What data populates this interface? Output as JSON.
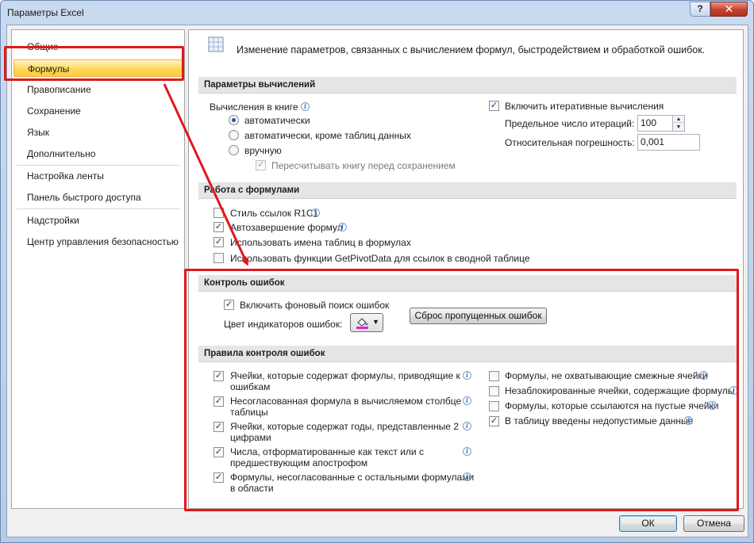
{
  "window": {
    "title": "Параметры Excel",
    "help_label": "?",
    "close_label": "✕"
  },
  "sidebar": {
    "items": [
      {
        "label": "Общие"
      },
      {
        "label": "Формулы",
        "selected": true
      },
      {
        "label": "Правописание"
      },
      {
        "label": "Сохранение"
      },
      {
        "label": "Язык"
      },
      {
        "label": "Дополнительно"
      },
      {
        "label": "Настройка ленты"
      },
      {
        "label": "Панель быстрого доступа"
      },
      {
        "label": "Надстройки"
      },
      {
        "label": "Центр управления безопасностью"
      }
    ]
  },
  "header": {
    "icon": "fx-formula-icon",
    "icon_glyph": "fx",
    "text": "Изменение параметров, связанных с вычислением формул, быстродействием и обработкой ошибок."
  },
  "calc": {
    "title": "Параметры вычислений",
    "workbook_label": "Вычисления в книге",
    "mode_auto": "автоматически",
    "mode_auto_except": "автоматически, кроме таблиц данных",
    "mode_manual": "вручную",
    "recalc_before_save": "Пересчитывать книгу перед сохранением",
    "iterative": "Включить итеративные вычисления",
    "max_iter_label": "Предельное число итераций:",
    "max_iter_value": "100",
    "max_change_label": "Относительная погрешность:",
    "max_change_value": "0,001",
    "selected_mode": "auto"
  },
  "formulas": {
    "title": "Работа с формулами",
    "r1c1": "Стиль ссылок R1C1",
    "autocomplete": "Автозавершение формул",
    "table_names": "Использовать имена таблиц в формулах",
    "getpivot": "Использовать функции GetPivotData для ссылок в сводной таблице"
  },
  "errors": {
    "title": "Контроль ошибок",
    "background": "Включить фоновый поиск ошибок",
    "indicator_color_label": "Цвет индикаторов ошибок:",
    "indicator_color": "#e820d0",
    "reset_button": "Сброс пропущенных ошибок"
  },
  "rules": {
    "title": "Правила контроля ошибок",
    "left": [
      {
        "line1": "Ячейки, которые содержат формулы, приводящие к",
        "line2": "ошибкам",
        "checked": true
      },
      {
        "line1": "Несогласованная формула в вычисляемом столбце",
        "line2": "таблицы",
        "checked": true
      },
      {
        "line1": "Ячейки, которые содержат годы, представленные 2",
        "line2": "цифрами",
        "checked": true
      },
      {
        "line1": "Числа, отформатированные как текст или с",
        "line2": "предшествующим апострофом",
        "checked": true
      },
      {
        "line1": "Формулы, несогласованные с остальными формулами",
        "line2": "в области",
        "checked": true
      }
    ],
    "right": [
      {
        "label": "Формулы, не охватывающие смежные ячейки",
        "checked": false
      },
      {
        "label": "Незаблокированные ячейки, содержащие формулы",
        "checked": false
      },
      {
        "label": "Формулы, которые ссылаются на пустые ячейки",
        "checked": false
      },
      {
        "label": "В таблицу введены недопустимые данные",
        "checked": true
      }
    ]
  },
  "footer": {
    "ok": "ОК",
    "cancel": "Отмена"
  },
  "glyphs": {
    "check": "✓",
    "info": "i",
    "spin_up": "▲",
    "spin_down": "▼",
    "dropdown": "▼"
  },
  "colors": {
    "highlight": "#e0181c",
    "selected_nav": "#ffd85a"
  }
}
